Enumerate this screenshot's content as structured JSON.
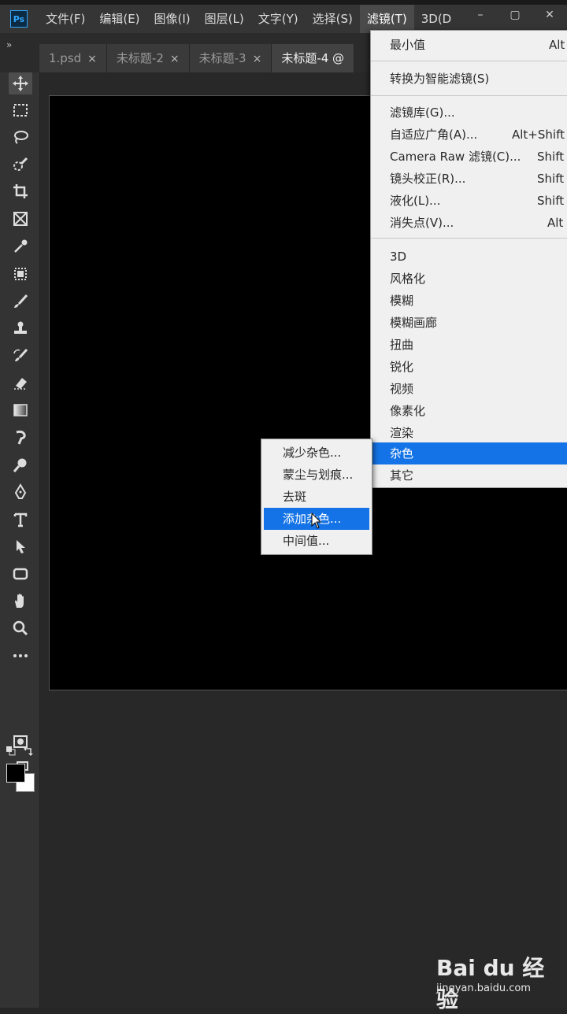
{
  "app": {
    "logo_text": "Ps",
    "window_controls": [
      "–",
      "▢",
      "✕"
    ]
  },
  "menubar": {
    "items": [
      {
        "label": "文件(F)"
      },
      {
        "label": "编辑(E)"
      },
      {
        "label": "图像(I)"
      },
      {
        "label": "图层(L)"
      },
      {
        "label": "文字(Y)"
      },
      {
        "label": "选择(S)"
      },
      {
        "label": "滤镜(T)"
      },
      {
        "label": "3D(D"
      }
    ]
  },
  "tabs": {
    "collapse_icon": "»",
    "items": [
      {
        "label": "1.psd",
        "close": "×"
      },
      {
        "label": "未标题-2",
        "close": "×"
      },
      {
        "label": "未标题-3",
        "close": "×"
      },
      {
        "label": "未标题-4 @",
        "close": ""
      }
    ]
  },
  "filter_menu": {
    "items": [
      {
        "label": "最小值",
        "shortcut": "Alt"
      },
      {
        "label": "转换为智能滤镜(S)",
        "shortcut": ""
      },
      {
        "label": "滤镜库(G)...",
        "shortcut": ""
      },
      {
        "label": "自适应广角(A)...",
        "shortcut": "Alt+Shift"
      },
      {
        "label": "Camera Raw 滤镜(C)...",
        "shortcut": "Shift"
      },
      {
        "label": "镜头校正(R)...",
        "shortcut": "Shift"
      },
      {
        "label": "液化(L)...",
        "shortcut": "Shift"
      },
      {
        "label": "消失点(V)...",
        "shortcut": "Alt"
      },
      {
        "label": "3D",
        "shortcut": ""
      },
      {
        "label": "风格化",
        "shortcut": ""
      },
      {
        "label": "模糊",
        "shortcut": ""
      },
      {
        "label": "模糊画廊",
        "shortcut": ""
      },
      {
        "label": "扭曲",
        "shortcut": ""
      },
      {
        "label": "锐化",
        "shortcut": ""
      },
      {
        "label": "视频",
        "shortcut": ""
      },
      {
        "label": "像素化",
        "shortcut": ""
      },
      {
        "label": "渲染",
        "shortcut": ""
      },
      {
        "label": "杂色",
        "shortcut": ""
      },
      {
        "label": "其它",
        "shortcut": ""
      }
    ]
  },
  "noise_submenu": {
    "items": [
      {
        "label": "减少杂色..."
      },
      {
        "label": "蒙尘与划痕..."
      },
      {
        "label": "去斑"
      },
      {
        "label": "添加杂色..."
      },
      {
        "label": "中间值..."
      }
    ]
  },
  "watermark": {
    "logo": "Bai du 经验",
    "url": "jingyan.baidu.com"
  },
  "colors": {
    "highlight": "#1473e6",
    "menubar_bg": "#353535",
    "toolbar_bg": "#333333",
    "document_bg": "#000000"
  }
}
